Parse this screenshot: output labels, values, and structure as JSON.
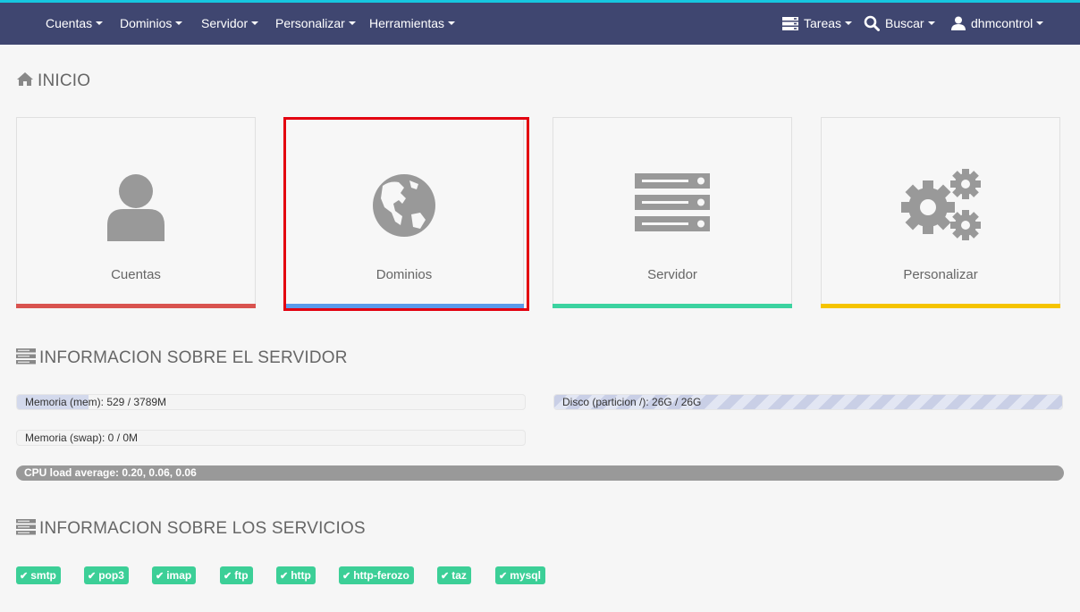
{
  "colors": {
    "navbar_bg": "#3f4670",
    "accent_stripe": "#16c7e0",
    "cuentas_bar": "#d9534f",
    "dominios_bar": "#5b9bea",
    "servidor_bar": "#3cd3a0",
    "personalizar_bar": "#f5c400",
    "service_ok": "#3ccf97",
    "highlight_outline": "#e3000f"
  },
  "nav": {
    "left": [
      {
        "label": "Cuentas"
      },
      {
        "label": "Dominios"
      },
      {
        "label": "Servidor"
      },
      {
        "label": "Personalizar"
      },
      {
        "label": "Herramientas"
      }
    ],
    "right": [
      {
        "label": "Tareas",
        "icon": "tasks-icon"
      },
      {
        "label": "Buscar",
        "icon": "search-icon"
      },
      {
        "label": "dhmcontrol",
        "icon": "user-icon"
      }
    ]
  },
  "home": {
    "title": "INICIO",
    "icon": "home-icon",
    "tiles": [
      {
        "label": "Cuentas",
        "icon": "user-icon"
      },
      {
        "label": "Dominios",
        "icon": "globe-icon"
      },
      {
        "label": "Servidor",
        "icon": "server-icon"
      },
      {
        "label": "Personalizar",
        "icon": "gears-icon"
      }
    ]
  },
  "server_info": {
    "title": "INFORMACION SOBRE EL SERVIDOR",
    "icon": "server-icon",
    "memory": {
      "label": "Memoria (mem): 529 / 3789M",
      "used_fraction": 0.14
    },
    "disk": {
      "label": "Disco (particion /): 26G / 26G",
      "used_fraction": 1.0
    },
    "swap": {
      "label": "Memoria (swap): 0 / 0M",
      "used_fraction": 0.0
    },
    "cpu": {
      "label": "CPU load average: 0.20, 0.06, 0.06"
    }
  },
  "services": {
    "title": "INFORMACION SOBRE LOS SERVICIOS",
    "icon": "server-icon",
    "items": [
      "smtp",
      "pop3",
      "imap",
      "ftp",
      "http",
      "http-ferozo",
      "taz",
      "mysql"
    ]
  }
}
